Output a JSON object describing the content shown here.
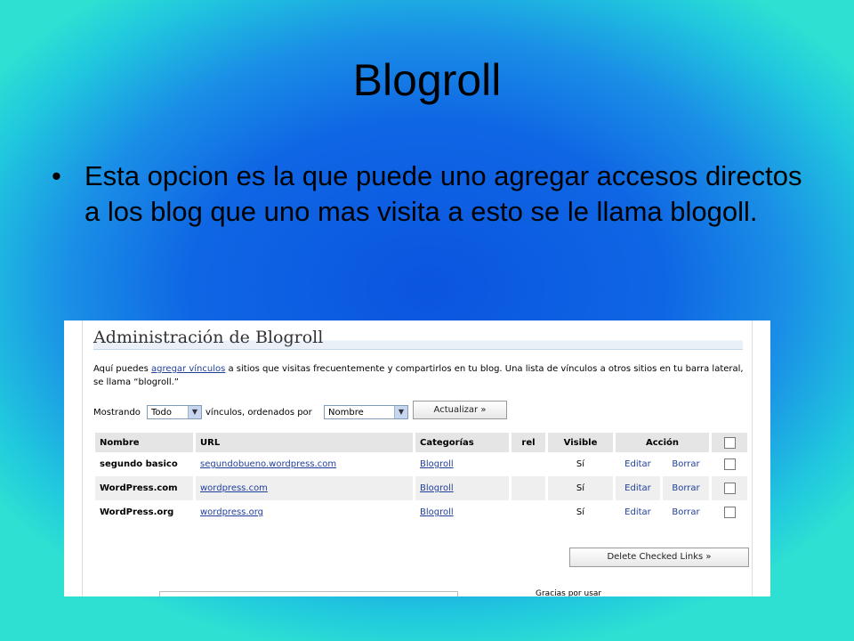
{
  "slide": {
    "title": "Blogroll",
    "bullet_char": "•",
    "bullet_text": "Esta opcion es la que puede uno agregar accesos directos a los blog que uno mas visita a esto se le llama blogoll."
  },
  "screenshot": {
    "heading": "Administración de Blogroll",
    "intro_before": "Aquí puedes ",
    "intro_link": "agregar vínculos",
    "intro_after": " a sitios que visitas frecuentemente y compartirlos en tu blog. Una lista de vínculos a otros sitios en tu barra lateral, se llama “blogroll.”",
    "showing_label": "Mostrando",
    "show_select_value": "Todo",
    "links_ordered_label": "vínculos, ordenados por",
    "order_select_value": "Nombre",
    "update_button": "Actualizar »",
    "columns": {
      "name": "Nombre",
      "url": "URL",
      "categories": "Categorías",
      "rel": "rel",
      "visible": "Visible",
      "action": "Acción"
    },
    "rows": [
      {
        "name": "segundo basico",
        "url": "segundobueno.wordpress.com",
        "category": "Blogroll",
        "rel": "",
        "visible": "Sí",
        "edit": "Editar",
        "delete": "Borrar"
      },
      {
        "name": "WordPress.com",
        "url": "wordpress.com",
        "category": "Blogroll",
        "rel": "",
        "visible": "Sí",
        "edit": "Editar",
        "delete": "Borrar"
      },
      {
        "name": "WordPress.org",
        "url": "wordpress.org",
        "category": "Blogroll",
        "rel": "",
        "visible": "Sí",
        "edit": "Editar",
        "delete": "Borrar"
      }
    ],
    "delete_checked_button": "Delete Checked Links »",
    "footer_text": "Gracias por usar"
  }
}
